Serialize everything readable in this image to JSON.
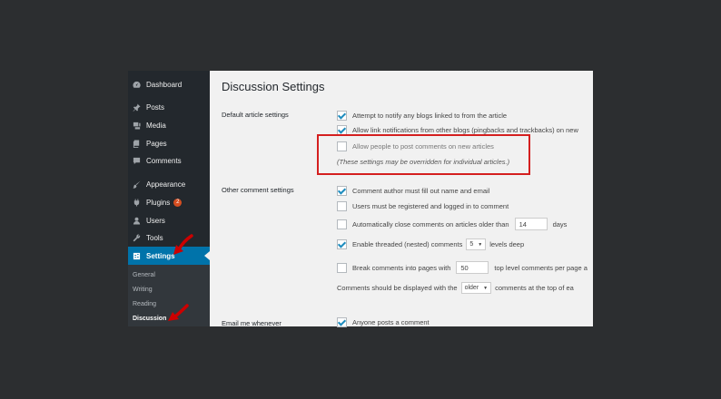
{
  "sidebar": {
    "items": [
      {
        "label": "Dashboard",
        "icon": "dashboard-icon"
      },
      {
        "label": "Posts",
        "icon": "pin-icon"
      },
      {
        "label": "Media",
        "icon": "media-icon"
      },
      {
        "label": "Pages",
        "icon": "pages-icon"
      },
      {
        "label": "Comments",
        "icon": "comments-icon"
      },
      {
        "label": "Appearance",
        "icon": "brush-icon"
      },
      {
        "label": "Plugins",
        "icon": "plug-icon",
        "badge": "2"
      },
      {
        "label": "Users",
        "icon": "user-icon"
      },
      {
        "label": "Tools",
        "icon": "wrench-icon"
      },
      {
        "label": "Settings",
        "icon": "settings-icon"
      }
    ],
    "submenu": [
      "General",
      "Writing",
      "Reading",
      "Discussion"
    ]
  },
  "main": {
    "title": "Discussion Settings",
    "sections": {
      "default_article": "Default article settings",
      "other_comment": "Other comment settings",
      "email_me": "Email me whenever"
    },
    "options": {
      "notify_blogs": "Attempt to notify any blogs linked to from the article",
      "allow_link_notifications": "Allow link notifications from other blogs (pingbacks and trackbacks) on new",
      "allow_comments": "Allow people to post comments on new articles",
      "override_note": "(These settings may be overridden for individual articles.)",
      "author_fill": "Comment author must fill out name and email",
      "registered": "Users must be registered and logged in to comment",
      "auto_close_prefix": "Automatically close comments on articles older than",
      "auto_close_days": "14",
      "auto_close_suffix": "days",
      "threaded_prefix": "Enable threaded (nested) comments",
      "threaded_levels": "5",
      "threaded_suffix": "levels deep",
      "break_prefix": "Break comments into pages with",
      "break_count": "50",
      "break_suffix": "top level comments per page a",
      "display_prefix": "Comments should be displayed with the",
      "display_order": "older",
      "display_suffix": "comments at the top of ea",
      "anyone_posts": "Anyone posts a comment"
    }
  }
}
